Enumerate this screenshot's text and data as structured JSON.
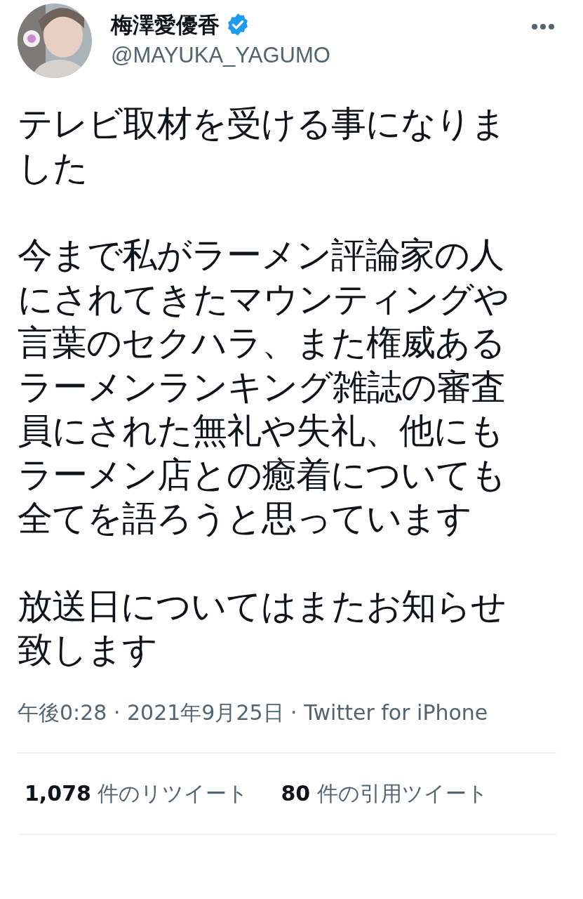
{
  "author": {
    "name": "梅澤愛優香",
    "verified": true,
    "handle": "@MAYUKA_YAGUMO"
  },
  "body": [
    [
      "テレビ取材を受ける事になりま",
      "した"
    ],
    [
      "今まで私がラーメン評論家の人",
      "にされてきたマウンティングや",
      "言葉のセクハラ、また権威ある",
      "ラーメンランキング雑誌の審査",
      "員にされた無礼や失礼、他にも",
      "ラーメン店との癒着についても",
      "全てを語ろうと思っています"
    ],
    [
      "放送日についてはまたお知らせ",
      "致します"
    ]
  ],
  "meta": "午後0:28 · 2021年9月25日 · Twitter for iPhone",
  "stats": [
    {
      "count": "1,078",
      "label": "件のリツイート"
    },
    {
      "count": "80",
      "label": "件の引用ツイート"
    }
  ]
}
